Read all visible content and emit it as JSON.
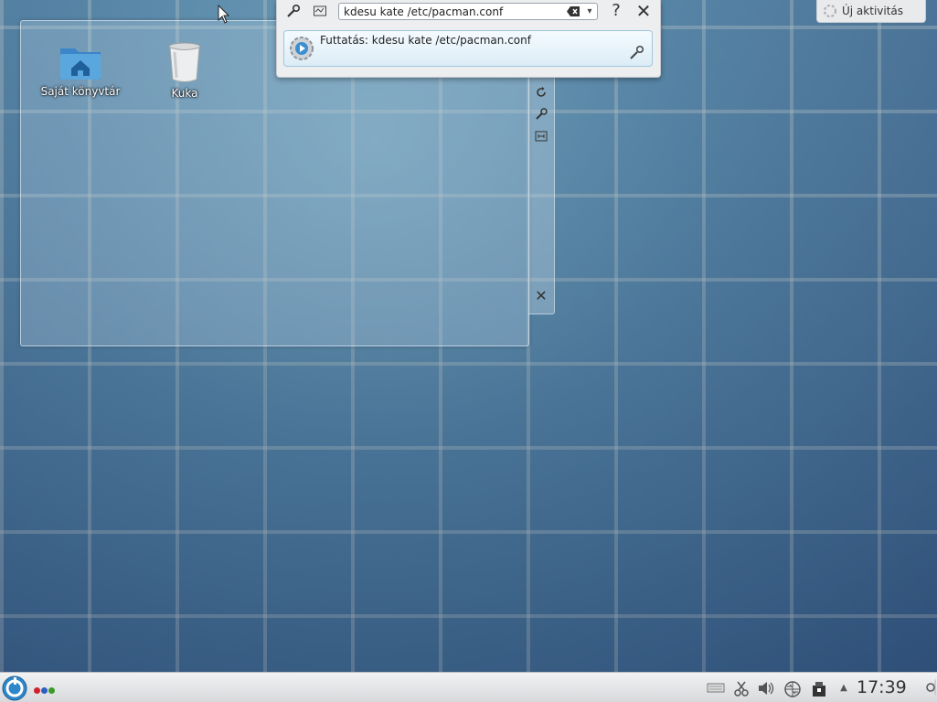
{
  "desktop": {
    "icons": [
      {
        "label": "Saját könyvtár",
        "icon": "home-folder-icon"
      },
      {
        "label": "Kuka",
        "icon": "trash-icon"
      }
    ]
  },
  "krunner": {
    "query": "kdesu kate /etc/pacman.conf",
    "result_label": "Futtatás: kdesu kate /etc/pacman.conf",
    "help_label": "?",
    "close_label": "✕"
  },
  "activity": {
    "label": "Új aktivitás"
  },
  "panel": {
    "clock": "17:39",
    "pager_colors": [
      "#d0202a",
      "#2d5ec2",
      "#3a9a2a"
    ]
  },
  "colors": {
    "accent": "#3b8fd0"
  }
}
